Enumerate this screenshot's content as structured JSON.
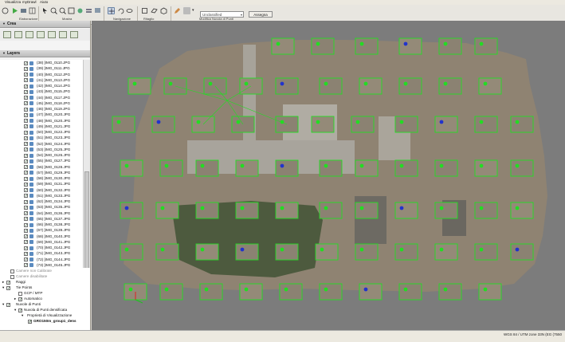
{
  "menu": [
    "Visualizza",
    "myDrawl",
    "Aiuto"
  ],
  "toolbar": {
    "groups": [
      "Elaborazione",
      "Mostra",
      "Navigazione",
      "Ritaglio",
      "Modifica Nuvola di Punti"
    ],
    "classification_select": "Unclassified",
    "assign_button": "Assegna"
  },
  "panels": {
    "crea_title": "Crea",
    "layers_title": "Layers"
  },
  "layers": [
    "(38) [IMG_0110.JPG",
    "(39) [IMG_0111.JPG",
    "(40) [IMG_0112.JPG",
    "(41) [IMG_0113.JPG",
    "(42) [IMG_0114.JPG",
    "(43) [IMG_0115.JPG",
    "(44) [IMG_0117.JPG",
    "(45) [IMG_0118.JPG",
    "(46) [IMG_0119.JPG",
    "(47) [IMG_0120.JPG",
    "(48) [IMG_0120.JPG",
    "(49) [IMG_0121.JPG",
    "(50) [IMG_0122.JPG",
    "(51) [IMG_0123.JPG",
    "(52) [IMG_0124.JPG",
    "(53) [IMG_0125.JPG",
    "(54) [IMG_0126.JPG",
    "(55) [IMG_0127.JPG",
    "(56) [IMG_0128.JPG",
    "(57) [IMG_0129.JPG",
    "(58) [IMG_0130.JPG",
    "(59) [IMG_0131.JPG",
    "(60) [IMG_0132.JPG",
    "(61) [IMG_0133.JPG",
    "(62) [IMG_0134.JPG",
    "(63) [IMG_0135.JPG",
    "(64) [IMG_0136.JPG",
    "(65) [IMG_0137.JPG",
    "(66) [IMG_0138.JPG",
    "(67) [IMG_0139.JPG",
    "(68) [IMG_0140.JPG",
    "(69) [IMG_0141.JPG",
    "(70) [IMG_0142.JPG",
    "(71) [IMG_0143.JPG",
    "(72) [IMG_0144.JPG",
    "(73) [IMG_0145.JPG"
  ],
  "tree": {
    "camere_non_calibrate": "Camere non Calibrate",
    "camere_disabilitate": "Camere disabilitate",
    "raggi": "Raggi",
    "tie_points": "Tie Points",
    "gcp_mtp": "GCP / MTP",
    "automatico": "Automatico",
    "nuvole_di_punti": "Nuvole di Punti",
    "nuvola_densificata": "Nuvola di Punti densificata",
    "proprieta": "Proprietà di Visualizzazione",
    "cloud_name": "GRO150m_group1_dens"
  },
  "status": {
    "coordinates": "WGS 84 / UTM zone 33N (EG (7550"
  },
  "colors": {
    "camera_marker": "#22dd22",
    "camera_blue": "#2233cc",
    "background": "#7c7c7c",
    "ground": "#8f8372"
  }
}
